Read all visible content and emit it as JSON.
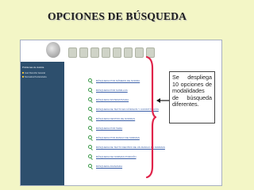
{
  "slide": {
    "title": "OPCIONES DE BÚSQUEDA"
  },
  "sidebar": {
    "heading": "Problemas de Justicia",
    "items": [
      "Juez Derecho General",
      "Normativa Penitenciaria"
    ]
  },
  "options": [
    "BÚSQUEDA POR NÚMERO DE NORMA",
    "BÚSQUEDA POR SUMILLAS",
    "BÚSQUEDA SISTEMATIZADA",
    "BÚSQUEDA DE TEXTO EN CÓDIGOS Y CONSTITUCIÓN",
    "BÚSQUEDA DENTRO DE NORMAS",
    "BÚSQUEDA POR TEMA",
    "BÚSQUEDA POR RANGO DE NORMAS",
    "BÚSQUEDA DE TEXTO DENTRO DE UN RANGO DE NORMAS",
    "BÚSQUEDA DE NORMAS PORCIÓN",
    "BÚSQUEDA AVANZADA"
  ],
  "callout": {
    "text": "Se despliega 10 opciones de modalidades de búsqueda diferentes."
  },
  "colors": {
    "background": "#f3f6c6",
    "sidebar": "#2d4f6d",
    "brace": "#e0234a",
    "arrow": "#1a1a1a",
    "icon": "#3c9a4a"
  }
}
